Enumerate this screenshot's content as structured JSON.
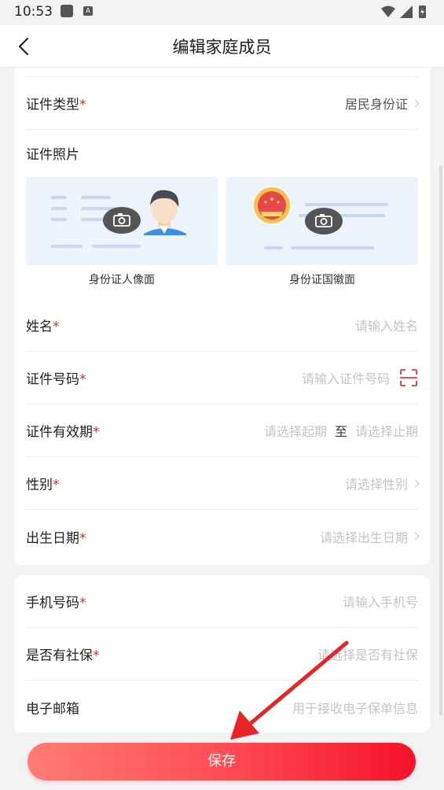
{
  "status_bar": {
    "time": "10:53"
  },
  "nav": {
    "title": "编辑家庭成员"
  },
  "form": {
    "id_type": {
      "label": "证件类型",
      "value": "居民身份证"
    },
    "photo": {
      "label": "证件照片",
      "front_caption": "身份证人像面",
      "back_caption": "身份证国徽面"
    },
    "name": {
      "label": "姓名",
      "placeholder": "请输入姓名"
    },
    "id_number": {
      "label": "证件号码",
      "placeholder": "请输入证件号码"
    },
    "validity": {
      "label": "证件有效期",
      "start_placeholder": "请选择起期",
      "separator": "至",
      "end_placeholder": "请选择止期"
    },
    "gender": {
      "label": "性别",
      "placeholder": "请选择性别"
    },
    "birth_date": {
      "label": "出生日期",
      "placeholder": "请选择出生日期"
    },
    "phone": {
      "label": "手机号码",
      "placeholder": "请输入手机号"
    },
    "social_security": {
      "label": "是否有社保",
      "placeholder": "请选择是否有社保"
    },
    "email": {
      "label": "电子邮箱",
      "placeholder": "用于接收电子保单信息"
    },
    "required_mark": "*"
  },
  "actions": {
    "save_label": "保存"
  },
  "colors": {
    "accent": "#f5112a",
    "required": "#e8262c",
    "placeholder": "#c4c4c4",
    "annotation_arrow": "#e82424"
  },
  "icons": [
    "back-arrow-icon",
    "chevron-right-icon",
    "scan-icon",
    "camera-icon",
    "wifi-icon",
    "signal-icon",
    "battery-icon"
  ]
}
